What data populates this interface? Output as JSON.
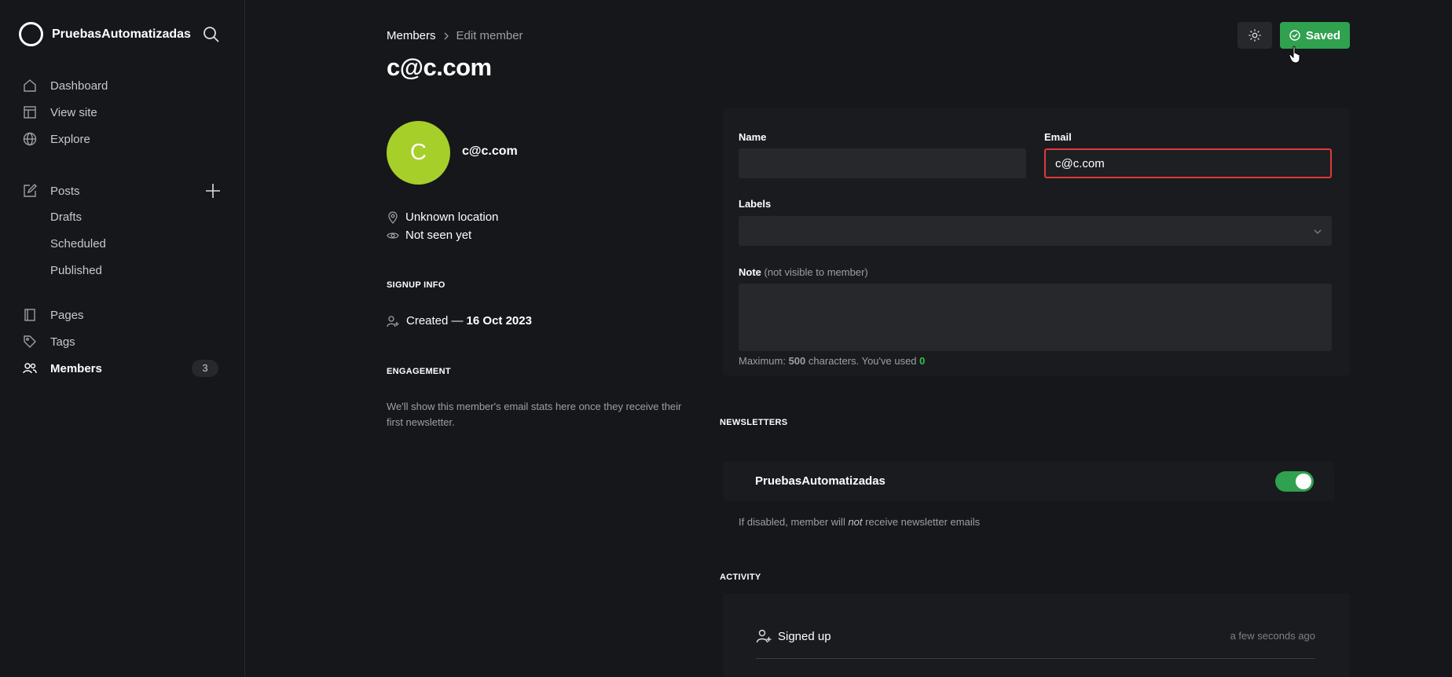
{
  "sidebar": {
    "brand": "PruebasAutomatizadas",
    "primary": [
      {
        "label": "Dashboard",
        "icon": "home-icon"
      },
      {
        "label": "View site",
        "icon": "layout-icon"
      },
      {
        "label": "Explore",
        "icon": "globe-icon"
      }
    ],
    "posts": {
      "label": "Posts",
      "sub": [
        "Drafts",
        "Scheduled",
        "Published"
      ]
    },
    "secondary": [
      {
        "label": "Pages",
        "icon": "pages-icon"
      },
      {
        "label": "Tags",
        "icon": "tag-icon"
      },
      {
        "label": "Members",
        "icon": "members-icon",
        "count": "3",
        "active": true
      }
    ]
  },
  "header": {
    "breadcrumb_parent": "Members",
    "breadcrumb_current": "Edit member",
    "title": "c@c.com",
    "save_label": "Saved"
  },
  "summary": {
    "avatar_initial": "C",
    "email": "c@c.com",
    "location": "Unknown location",
    "last_seen": "Not seen yet",
    "signup_heading": "SIGNUP INFO",
    "created_prefix": "Created —",
    "created_date": "16 Oct 2023",
    "engagement_heading": "ENGAGEMENT",
    "engagement_text": "We'll show this member's email stats here once they receive their first newsletter."
  },
  "form": {
    "name_label": "Name",
    "name_value": "",
    "email_label": "Email",
    "email_value": "c@c.com",
    "labels_label": "Labels",
    "note_label": "Note",
    "note_hint": "(not visible to member)",
    "counter_prefix": "Maximum:",
    "counter_max": "500",
    "counter_mid": "characters. You've used",
    "counter_used": "0"
  },
  "newsletters": {
    "heading": "NEWSLETTERS",
    "name": "PruebasAutomatizadas",
    "enabled": true,
    "hint_prefix": "If disabled, member will",
    "hint_em": "not",
    "hint_suffix": "receive newsletter emails"
  },
  "activity": {
    "heading": "ACTIVITY",
    "items": [
      {
        "label": "Signed up",
        "time": "a few seconds ago"
      }
    ]
  },
  "colors": {
    "accent": "#30a14e",
    "error": "#e0383b",
    "avatar": "#a6cf2a"
  }
}
